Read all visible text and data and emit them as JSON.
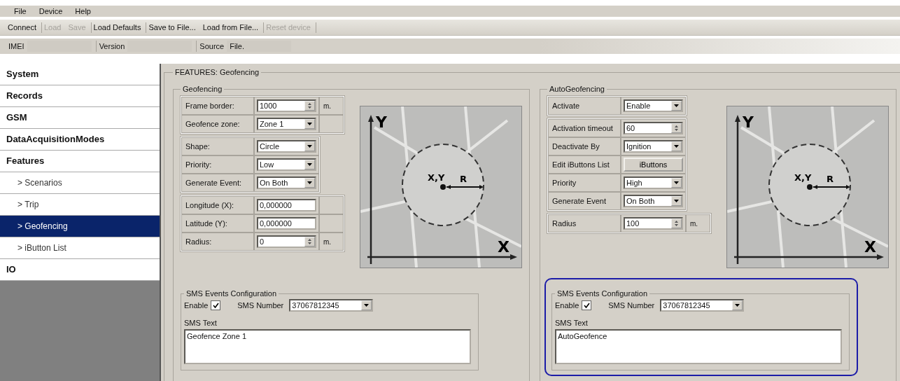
{
  "menu": [
    "File",
    "Device",
    "Help"
  ],
  "toolbar": [
    [
      {
        "label": "Connect",
        "disabled": false
      }
    ],
    [
      {
        "label": "Load",
        "disabled": true
      },
      {
        "label": "Save",
        "disabled": true
      }
    ],
    [
      {
        "label": "Load Defaults",
        "disabled": false
      }
    ],
    [
      {
        "label": "Save to File...",
        "disabled": false
      },
      {
        "label": "Load from File...",
        "disabled": false
      }
    ],
    [
      {
        "label": "Reset device",
        "disabled": true
      }
    ]
  ],
  "info_bar": [
    {
      "label": "IMEI"
    },
    {
      "label": "Version"
    },
    {
      "label": "Source",
      "value": "File."
    }
  ],
  "sidebar": [
    {
      "label": "System",
      "selected": false
    },
    {
      "label": "Records",
      "selected": false
    },
    {
      "label": "GSM",
      "selected": false
    },
    {
      "label": "DataAcquisitionModes",
      "selected": false
    },
    {
      "label": "Features",
      "selected": false,
      "children": [
        {
          "label": "> Scenarios",
          "selected": false
        },
        {
          "label": "> Trip",
          "selected": false
        },
        {
          "label": "> Geofencing",
          "selected": true
        },
        {
          "label": "> iButton List",
          "selected": false
        }
      ]
    },
    {
      "label": "IO",
      "selected": false
    }
  ],
  "panel_title": "FEATURES: Geofencing",
  "groups": [
    {
      "title": "Geofencing",
      "blocks": [
        [
          {
            "label": "Frame border:",
            "kind": "spin",
            "value": "1000",
            "unit": "m."
          },
          {
            "label": "Geofence zone:",
            "kind": "select",
            "value": "Zone 1"
          }
        ],
        [
          {
            "label": "Shape:",
            "kind": "select",
            "value": "Circle"
          },
          {
            "label": "Priority:",
            "kind": "select",
            "value": "Low"
          },
          {
            "label": "Generate Event:",
            "kind": "select",
            "value": "On Both"
          }
        ],
        [
          {
            "label": "Longitude (X):",
            "kind": "text",
            "value": "0,000000"
          },
          {
            "label": "Latitude (Y):",
            "kind": "text",
            "value": "0,000000"
          },
          {
            "label": "Radius:",
            "kind": "spin",
            "value": "0",
            "unit": "m."
          }
        ]
      ],
      "diagram": {
        "y_axis": "Y",
        "x_axis": "X",
        "center": "X,Y",
        "radius": "R"
      },
      "sms": {
        "title": "SMS Events Configuration",
        "enable_label": "Enable",
        "enabled": true,
        "number_label": "SMS Number",
        "number": "37067812345",
        "text_label": "SMS Text",
        "text": "Geofence Zone 1",
        "highlighted": false
      }
    },
    {
      "title": "AutoGeofencing",
      "blocks": [
        [
          {
            "label": "Activate",
            "kind": "select",
            "value": "Enable"
          }
        ],
        [
          {
            "label": "Activation timeout",
            "kind": "spin",
            "value": "60"
          },
          {
            "label": "Deactivate By",
            "kind": "select",
            "value": "Ignition"
          },
          {
            "label": "Edit iButtons List",
            "kind": "button",
            "value": "iButtons"
          },
          {
            "label": "Priority",
            "kind": "select",
            "value": "High"
          },
          {
            "label": "Generate Event",
            "kind": "select",
            "value": "On Both"
          }
        ],
        [
          {
            "label": "Radius",
            "kind": "spin",
            "value": "100",
            "unit": "m."
          }
        ]
      ],
      "diagram": {
        "y_axis": "Y",
        "x_axis": "X",
        "center": "X,Y",
        "radius": "R"
      },
      "sms": {
        "title": "SMS Events Configuration",
        "enable_label": "Enable",
        "enabled": true,
        "number_label": "SMS Number",
        "number": "37067812345",
        "text_label": "SMS Text",
        "text": "AutoGeofence",
        "highlighted": true
      }
    }
  ]
}
